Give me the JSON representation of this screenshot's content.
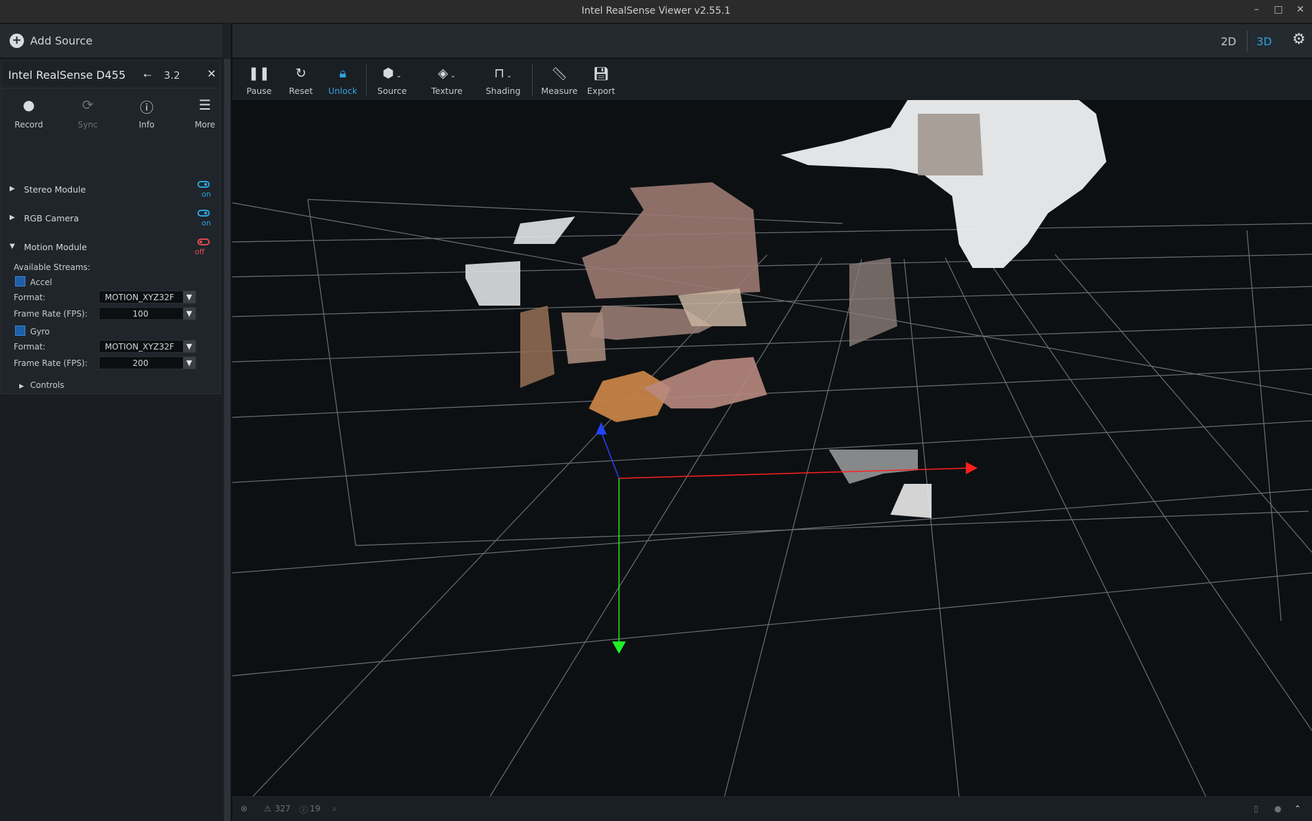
{
  "window": {
    "title": "Intel RealSense Viewer v2.55.1"
  },
  "sidebar": {
    "add_source_label": "Add Source",
    "device": {
      "name": "Intel RealSense D455",
      "usb_version": "3.2",
      "buttons": [
        {
          "label": "Record",
          "icon": "record-icon"
        },
        {
          "label": "Sync",
          "icon": "sync-icon"
        },
        {
          "label": "Info",
          "icon": "info-icon"
        },
        {
          "label": "More",
          "icon": "menu-icon"
        }
      ],
      "modules": [
        {
          "name": "Stereo Module",
          "state": "on"
        },
        {
          "name": "RGB Camera",
          "state": "on"
        },
        {
          "name": "Motion Module",
          "state": "off"
        }
      ],
      "motion": {
        "available_streams_label": "Available Streams:",
        "streams": [
          {
            "name": "Accel",
            "format_label": "Format:",
            "format": "MOTION_XYZ32F",
            "fps_label": "Frame Rate (FPS):",
            "fps": "100"
          },
          {
            "name": "Gyro",
            "format_label": "Format:",
            "format": "MOTION_XYZ32F",
            "fps_label": "Frame Rate (FPS):",
            "fps": "200"
          }
        ],
        "controls_label": "Controls"
      }
    }
  },
  "view_mode": {
    "two_d": "2D",
    "three_d": "3D",
    "active": "3D"
  },
  "toolbar": {
    "items": [
      {
        "label": "Pause",
        "icon": "pause-icon"
      },
      {
        "label": "Reset",
        "icon": "reset-icon"
      },
      {
        "label": "Unlock",
        "icon": "lock-icon",
        "active": true
      },
      {
        "label": "Source",
        "icon": "cube-icon"
      },
      {
        "label": "Texture",
        "icon": "paint-bucket-icon"
      },
      {
        "label": "Shading",
        "icon": "paint-roller-icon"
      },
      {
        "label": "Measure",
        "icon": "ruler-icon"
      },
      {
        "label": "Export",
        "icon": "save-icon"
      }
    ]
  },
  "status_bar": {
    "warnings": "327",
    "info": "19"
  },
  "colors": {
    "accent": "#2ea4e0",
    "off": "#e04b4b",
    "axis_x": "#ff2020",
    "axis_y": "#22ee22",
    "axis_z": "#2244ff"
  }
}
